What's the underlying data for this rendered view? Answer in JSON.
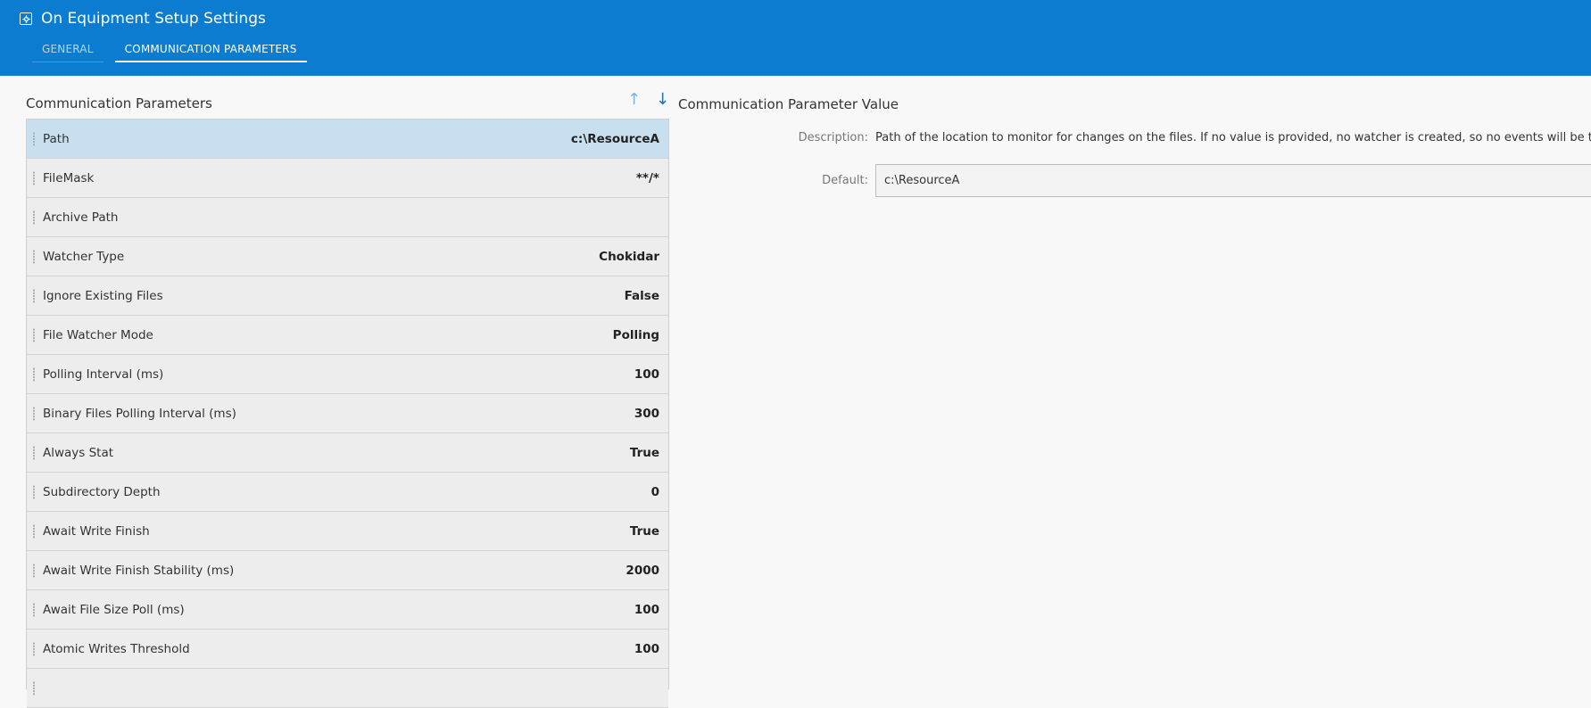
{
  "header": {
    "title": "On Equipment Setup Settings",
    "icon": "settings-icon",
    "background": "#0b7ccf"
  },
  "tabs": [
    {
      "label": "GENERAL",
      "active": false
    },
    {
      "label": "COMMUNICATION PARAMETERS",
      "active": true
    }
  ],
  "left_panel": {
    "title": "Communication Parameters",
    "sort_up_icon": "arrow-up-icon",
    "sort_down_icon": "arrow-down-icon",
    "rows": [
      {
        "label": "Path",
        "value": "c:\\ResourceA",
        "selected": true
      },
      {
        "label": "FileMask",
        "value": "**/*"
      },
      {
        "label": "Archive Path",
        "value": ""
      },
      {
        "label": "Watcher Type",
        "value": "Chokidar"
      },
      {
        "label": "Ignore Existing Files",
        "value": "False"
      },
      {
        "label": "File Watcher Mode",
        "value": "Polling"
      },
      {
        "label": "Polling Interval (ms)",
        "value": "100"
      },
      {
        "label": "Binary Files Polling Interval (ms)",
        "value": "300"
      },
      {
        "label": "Always Stat",
        "value": "True"
      },
      {
        "label": "Subdirectory Depth",
        "value": "0"
      },
      {
        "label": "Await Write Finish",
        "value": "True"
      },
      {
        "label": "Await Write Finish Stability (ms)",
        "value": "2000"
      },
      {
        "label": "Await File Size Poll (ms)",
        "value": "100"
      },
      {
        "label": "Atomic Writes Threshold",
        "value": "100"
      },
      {
        "label": "",
        "value": ""
      }
    ]
  },
  "right_panel": {
    "title": "Communication Parameter Value",
    "description_label": "Description:",
    "description": "Path of the location to monitor for changes on the files. If no value is provided, no watcher is created, so no events will be triggered.",
    "default_label": "Default:",
    "default_value": "c:\\ResourceA"
  }
}
